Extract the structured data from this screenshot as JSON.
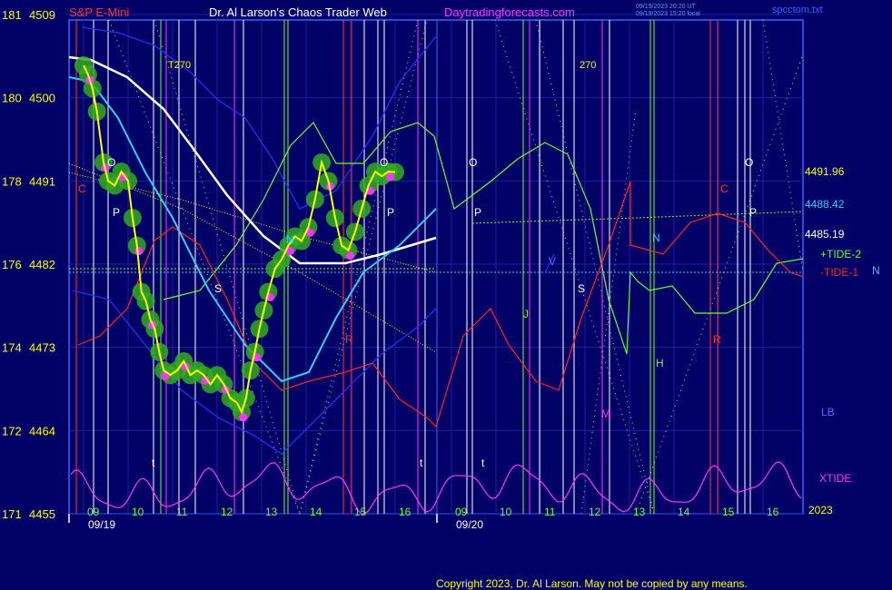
{
  "header": {
    "instrument": "S&P E-Mini",
    "author_title": "Dr. Al Larson's Chaos Trader Web",
    "site": "Daytradingforecasts.com",
    "update_line_1": "09/19/2023 20:20 UT",
    "update_line_2": "09/19/2023 15:20 local",
    "file_name": "spcctom.txt"
  },
  "footer": {
    "copyright": "Copyright 2023, Dr. Al Larson. May not be copied by any means."
  },
  "colors": {
    "background": "#000066",
    "frame": "#3366ff",
    "price": "#ffff00",
    "price_halo": "#33aa22",
    "price_lows": "#ff33ff",
    "moving_avg_white": "#ffffff",
    "moving_avg_cyan": "#33ccff",
    "tide_plus": "#66ff33",
    "tide_minus": "#ff2222",
    "xtide": "#ff33ff"
  },
  "chart_data": {
    "type": "line",
    "title": "S&P E-Mini",
    "y_axis_left": [
      {
        "prefix": "181",
        "price": "4509"
      },
      {
        "prefix": "180",
        "price": "4500"
      },
      {
        "prefix": "178",
        "price": "4491"
      },
      {
        "prefix": "176",
        "price": "4482"
      },
      {
        "prefix": "174",
        "price": "4473"
      },
      {
        "prefix": "172",
        "price": "4464"
      },
      {
        "prefix": "171",
        "price": "4455"
      }
    ],
    "ylim": [
      4455,
      4509
    ],
    "x_hour_ticks_day1": [
      "09",
      "10",
      "11",
      "12",
      "13",
      "14",
      "15",
      "16"
    ],
    "x_hour_ticks_day2": [
      "09",
      "10",
      "11",
      "12",
      "13",
      "14",
      "15",
      "16"
    ],
    "date_labels": [
      "09/19",
      "09/20"
    ],
    "year_label": "2023",
    "right_price_labels": [
      {
        "text": "4491.96",
        "color": "#ffff00"
      },
      {
        "text": "4488.42",
        "color": "#33ccff"
      },
      {
        "text": "4485.19",
        "color": "#ffffff"
      }
    ],
    "legend": [
      {
        "name": "+TIDE-2",
        "color": "#66ff33"
      },
      {
        "name": "-TIDE-1",
        "color": "#ff2222"
      },
      {
        "name": "N",
        "color": "#33ccff"
      },
      {
        "name": "LB",
        "color": "#6666ff"
      },
      {
        "name": "XTIDE",
        "color": "#ff33ff"
      }
    ],
    "cycle_markers": [
      "T270",
      "270"
    ],
    "chart_letters": [
      "O",
      "P",
      "S",
      "N",
      "R",
      "O",
      "P",
      "O",
      "P",
      "S",
      "J",
      "V",
      "N",
      "H",
      "M",
      "C",
      "R",
      "O",
      "P",
      "C",
      "t",
      "t",
      "t"
    ],
    "price_series": [
      {
        "t": 9.0,
        "y": 4503.5
      },
      {
        "t": 9.1,
        "y": 4502.5
      },
      {
        "t": 9.2,
        "y": 4501.0
      },
      {
        "t": 9.3,
        "y": 4498.5
      },
      {
        "t": 9.45,
        "y": 4493.0
      },
      {
        "t": 9.55,
        "y": 4491.0
      },
      {
        "t": 9.7,
        "y": 4490.5
      },
      {
        "t": 9.85,
        "y": 4492.0
      },
      {
        "t": 10.0,
        "y": 4491.0
      },
      {
        "t": 10.1,
        "y": 4487.0
      },
      {
        "t": 10.2,
        "y": 4484.0
      },
      {
        "t": 10.3,
        "y": 4479.0
      },
      {
        "t": 10.4,
        "y": 4478.0
      },
      {
        "t": 10.5,
        "y": 4476.0
      },
      {
        "t": 10.6,
        "y": 4475.0
      },
      {
        "t": 10.7,
        "y": 4472.5
      },
      {
        "t": 10.8,
        "y": 4470.5
      },
      {
        "t": 10.95,
        "y": 4470.0
      },
      {
        "t": 11.1,
        "y": 4470.5
      },
      {
        "t": 11.25,
        "y": 4471.5
      },
      {
        "t": 11.4,
        "y": 4470.0
      },
      {
        "t": 11.55,
        "y": 4470.5
      },
      {
        "t": 11.7,
        "y": 4470.0
      },
      {
        "t": 11.85,
        "y": 4469.0
      },
      {
        "t": 12.0,
        "y": 4470.0
      },
      {
        "t": 12.15,
        "y": 4469.0
      },
      {
        "t": 12.3,
        "y": 4467.5
      },
      {
        "t": 12.45,
        "y": 4467.0
      },
      {
        "t": 12.55,
        "y": 4466.0
      },
      {
        "t": 12.65,
        "y": 4467.5
      },
      {
        "t": 12.75,
        "y": 4470.5
      },
      {
        "t": 12.85,
        "y": 4472.5
      },
      {
        "t": 12.95,
        "y": 4475.0
      },
      {
        "t": 13.05,
        "y": 4477.0
      },
      {
        "t": 13.15,
        "y": 4479.0
      },
      {
        "t": 13.3,
        "y": 4481.5
      },
      {
        "t": 13.45,
        "y": 4482.5
      },
      {
        "t": 13.6,
        "y": 4484.0
      },
      {
        "t": 13.75,
        "y": 4485.0
      },
      {
        "t": 13.9,
        "y": 4484.5
      },
      {
        "t": 14.05,
        "y": 4486.0
      },
      {
        "t": 14.2,
        "y": 4489.0
      },
      {
        "t": 14.35,
        "y": 4493.0
      },
      {
        "t": 14.5,
        "y": 4491.0
      },
      {
        "t": 14.65,
        "y": 4487.0
      },
      {
        "t": 14.8,
        "y": 4484.0
      },
      {
        "t": 14.95,
        "y": 4483.5
      },
      {
        "t": 15.1,
        "y": 4485.5
      },
      {
        "t": 15.25,
        "y": 4488.0
      },
      {
        "t": 15.4,
        "y": 4490.5
      },
      {
        "t": 15.55,
        "y": 4492.0
      },
      {
        "t": 15.7,
        "y": 4491.5
      },
      {
        "t": 15.85,
        "y": 4492.0
      },
      {
        "t": 16.0,
        "y": 4491.96
      }
    ]
  }
}
